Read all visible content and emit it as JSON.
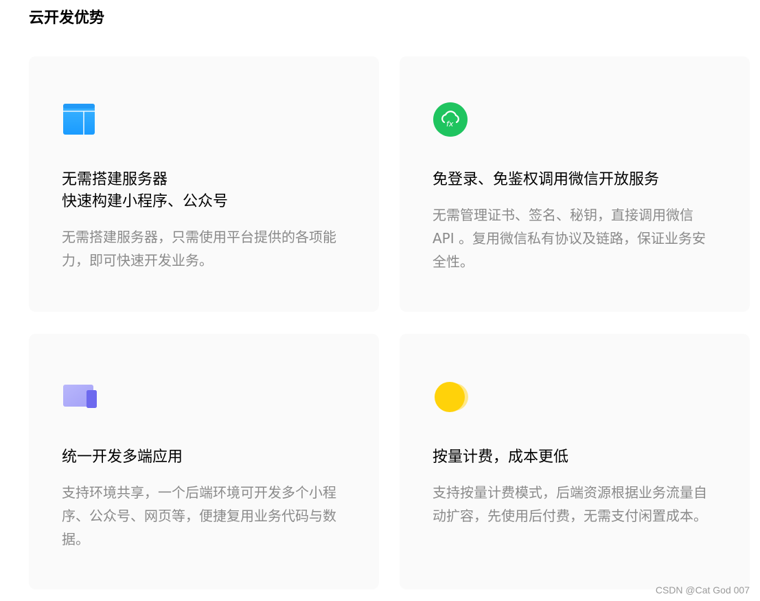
{
  "page": {
    "title": "云开发优势"
  },
  "cards": [
    {
      "icon": "window-layout-icon",
      "title": "无需搭建服务器\n快速构建小程序、公众号",
      "desc": "无需搭建服务器，只需使用平台提供的各项能力，即可快速开发业务。"
    },
    {
      "icon": "cloud-function-icon",
      "title": "免登录、免鉴权调用微信开放服务",
      "desc": "无需管理证书、签名、秘钥，直接调用微信 API 。复用微信私有协议及链路，保证业务安全性。"
    },
    {
      "icon": "multi-device-icon",
      "title": "统一开发多端应用",
      "desc": "支持环境共享，一个后端环境可开发多个小程序、公众号、网页等，便捷复用业务代码与数据。"
    },
    {
      "icon": "coins-icon",
      "title": "按量计费，成本更低",
      "desc": "支持按量计费模式，后端资源根据业务流量自动扩容，先使用后付费，无需支付闲置成本。"
    }
  ],
  "colors": {
    "card_background": "#fafafa",
    "window_icon": "#1fa5ff",
    "cloud_icon": "#1fc45f",
    "device_icon": "#7c79f2",
    "coin_icon": "#ffd20a",
    "desc_text": "#8a8a8a"
  },
  "watermark": "CSDN @Cat God 007"
}
